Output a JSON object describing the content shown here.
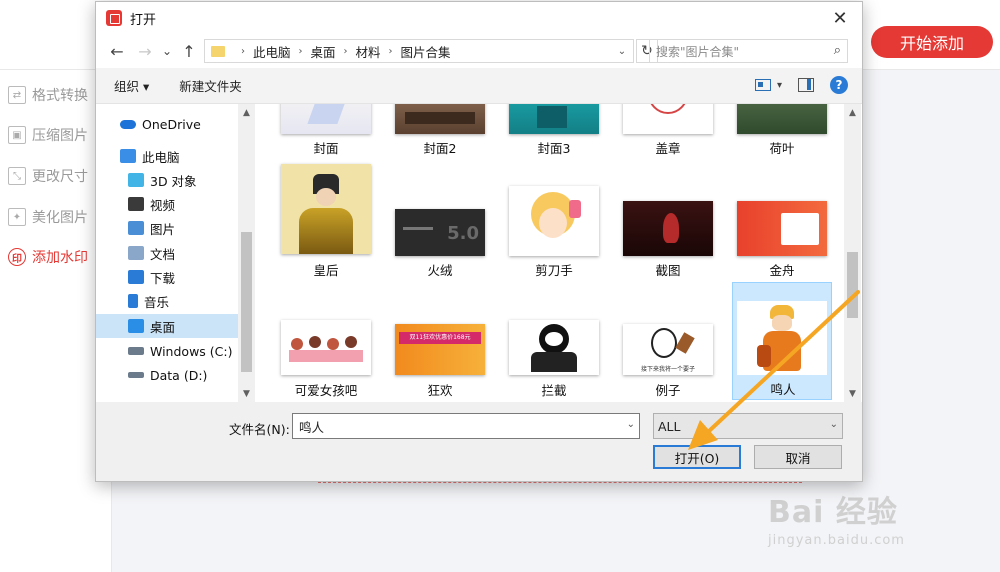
{
  "app": {
    "start_button": "开始添加",
    "sidebar": [
      {
        "label": "格式转换",
        "icon": "convert-icon",
        "glyph": "⇄"
      },
      {
        "label": "压缩图片",
        "icon": "compress-icon",
        "glyph": "▣"
      },
      {
        "label": "更改尺寸",
        "icon": "resize-icon",
        "glyph": "⤡"
      },
      {
        "label": "美化图片",
        "icon": "beautify-icon",
        "glyph": "✦"
      },
      {
        "label": "添加水印",
        "icon": "watermark-icon",
        "glyph": "印"
      }
    ]
  },
  "watermark": {
    "main": "Bai 经验",
    "sub": "jingyan.baidu.com"
  },
  "dialog": {
    "title": "打开",
    "close": "✕",
    "nav": {
      "back": "←",
      "forward": "→",
      "recent": "⌄",
      "up": "↑"
    },
    "breadcrumb": [
      "此电脑",
      "桌面",
      "材料",
      "图片合集"
    ],
    "refresh": "↻",
    "search_placeholder": "搜索\"图片合集\"",
    "toolbar": {
      "organize": "组织 ▾",
      "new_folder": "新建文件夹",
      "view_dropdown": "▾",
      "help": "?"
    },
    "nav_items": [
      {
        "label": "OneDrive",
        "icon": "onedrive-icon",
        "color": "#1e73d8"
      },
      {
        "label": "此电脑",
        "icon": "this-pc-icon",
        "color": "#3a8ee6"
      },
      {
        "label": "3D 对象",
        "icon": "3d-objects-icon",
        "color": "#42b4e6"
      },
      {
        "label": "视频",
        "icon": "video-icon",
        "color": "#3a3a3a"
      },
      {
        "label": "图片",
        "icon": "pictures-icon",
        "color": "#4a8fd6"
      },
      {
        "label": "文档",
        "icon": "documents-icon",
        "color": "#8aa6c8"
      },
      {
        "label": "下载",
        "icon": "downloads-icon",
        "color": "#2a7bd6"
      },
      {
        "label": "音乐",
        "icon": "music-icon",
        "color": "#2a7bd6"
      },
      {
        "label": "桌面",
        "icon": "desktop-icon",
        "color": "#2a8ee6"
      },
      {
        "label": "Windows (C:)",
        "icon": "drive-c-icon",
        "color": "#6b7b8c"
      },
      {
        "label": "Data (D:)",
        "icon": "drive-d-icon",
        "color": "#6b7b8c"
      }
    ],
    "files": [
      {
        "label": "封面",
        "thumb": "cover-thumb"
      },
      {
        "label": "封面2",
        "thumb": "cover2-thumb"
      },
      {
        "label": "封面3",
        "thumb": "cover3-thumb"
      },
      {
        "label": "盖章",
        "thumb": "stamp-thumb"
      },
      {
        "label": "荷叶",
        "thumb": "lotus-leaf-thumb"
      },
      {
        "label": "皇后",
        "thumb": "empress-thumb"
      },
      {
        "label": "火绒",
        "thumb": "huorong-thumb",
        "overlay": "5.0"
      },
      {
        "label": "剪刀手",
        "thumb": "scissor-hand-thumb"
      },
      {
        "label": "截图",
        "thumb": "screenshot-thumb"
      },
      {
        "label": "金舟",
        "thumb": "jinzhou-thumb"
      },
      {
        "label": "可爱女孩吧",
        "thumb": "cute-girls-thumb"
      },
      {
        "label": "狂欢",
        "thumb": "carnival-thumb",
        "overlay": "双11狂欢优惠价168元"
      },
      {
        "label": "拦截",
        "thumb": "intercept-thumb"
      },
      {
        "label": "例子",
        "thumb": "example-thumb",
        "overlay": "接下来我将一个要子"
      },
      {
        "label": "鸣人",
        "thumb": "naruto-thumb",
        "selected": true
      }
    ],
    "filename_label": "文件名(N):",
    "filename_value": "鸣人",
    "filetype": "ALL",
    "open_button": "打开(O)",
    "cancel_button": "取消"
  },
  "colors": {
    "brand_red": "#e53935",
    "arrow": "#f5a623",
    "selection": "#cce8ff"
  }
}
